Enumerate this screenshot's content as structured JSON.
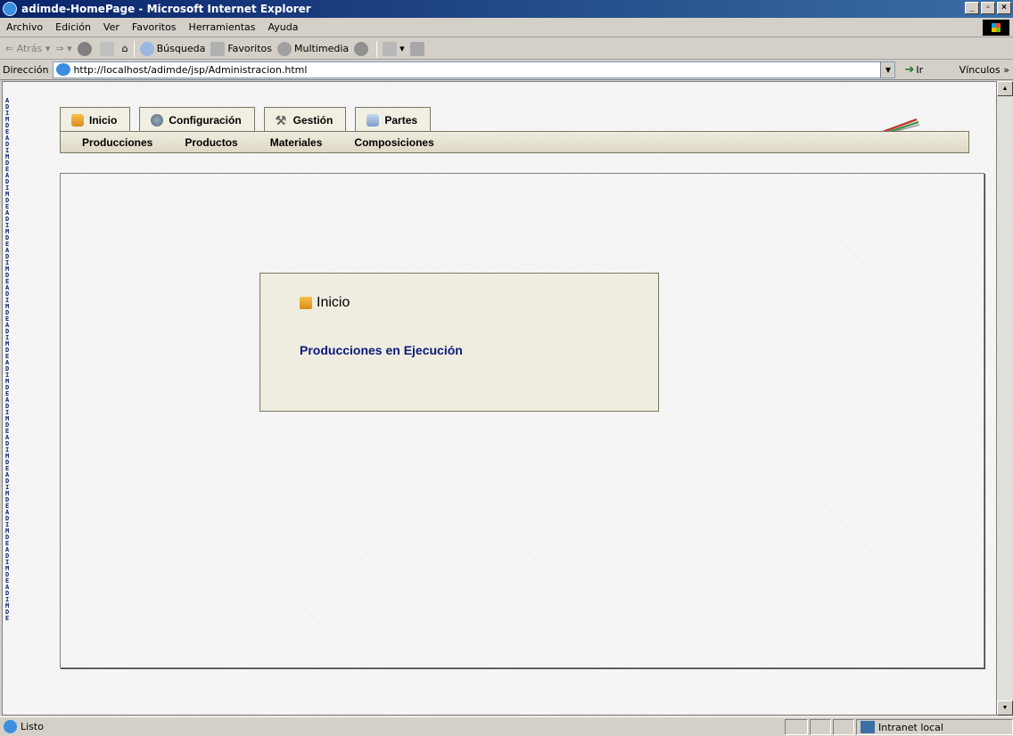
{
  "window": {
    "title": "adimde-HomePage - Microsoft Internet Explorer"
  },
  "menu": [
    "Archivo",
    "Edición",
    "Ver",
    "Favoritos",
    "Herramientas",
    "Ayuda"
  ],
  "toolbar": {
    "back": "Atrás",
    "search": "Búsqueda",
    "favorites": "Favoritos",
    "media": "Multimedia"
  },
  "address": {
    "label": "Dirección",
    "url": "http://localhost/adimde/jsp/Administracion.html",
    "go": "Ir",
    "links": "Vínculos"
  },
  "sidebar": {
    "watermark": "ADIMDE"
  },
  "tabs": [
    {
      "label": "Inicio",
      "icon": "home-icon"
    },
    {
      "label": "Configuración",
      "icon": "gear-icon"
    },
    {
      "label": "Gestión",
      "icon": "wrench-icon"
    },
    {
      "label": "Partes",
      "icon": "document-icon"
    }
  ],
  "subnav": [
    "Producciones",
    "Productos",
    "Materiales",
    "Composiciones"
  ],
  "panel": {
    "title": "Inicio",
    "link": "Producciones en Ejecución"
  },
  "status": {
    "text": "Listo",
    "zone": "Intranet local"
  },
  "colors": {
    "titlebar": "#0a246a",
    "panel_bg": "#efede0",
    "link": "#0a1a7a"
  }
}
